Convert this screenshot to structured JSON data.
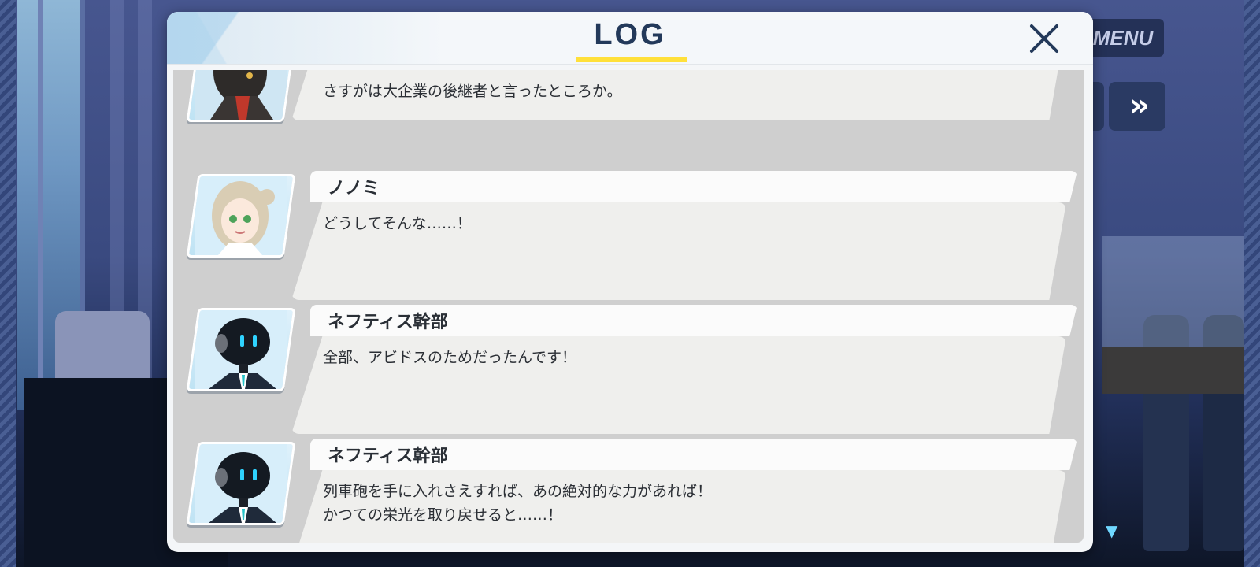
{
  "hud": {
    "menu_label": "MENU",
    "fast_forward_symbol": "»",
    "scroll_down_symbol": "▼"
  },
  "log": {
    "title": "LOG",
    "close_symbol": "✕",
    "entries": [
      {
        "speaker": "",
        "text_lines": [
          "さすがは大企業の後継者と言ったところか。"
        ],
        "portrait": "robot-officer-dark-avatar"
      },
      {
        "speaker": "ノノミ",
        "text_lines": [
          "どうしてそんな……！"
        ],
        "portrait": "nonomi-avatar"
      },
      {
        "speaker": "ネフティス幹部",
        "text_lines": [
          "全部、アビドスのためだったんです！"
        ],
        "portrait": "nefthys-executive-avatar"
      },
      {
        "speaker": "ネフティス幹部",
        "text_lines": [
          "列車砲を手に入れさえすれば、あの絶対的な力があれば！",
          "かつての栄光を取り戻せると……！"
        ],
        "portrait": "nefthys-executive-avatar"
      }
    ]
  },
  "colors": {
    "accent_yellow": "#ffe03a",
    "title_navy": "#23395a",
    "eye_cyan": "#2fd3ff"
  }
}
